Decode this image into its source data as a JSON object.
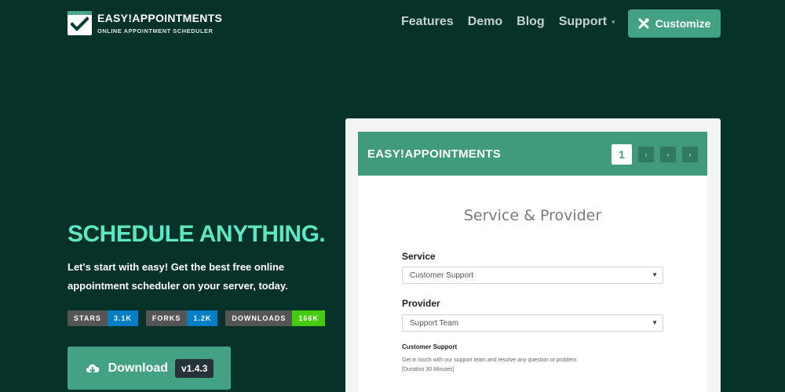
{
  "brand": {
    "title": "EASY!APPOINTMENTS",
    "subtitle": "ONLINE APPOINTMENT SCHEDULER",
    "icon": "calendar-check-icon"
  },
  "nav": {
    "items": [
      "Features",
      "Demo",
      "Blog",
      "Support"
    ],
    "support_caret": "▾",
    "customize_label": "Customize",
    "customize_icon": "tools-icon"
  },
  "hero": {
    "title": "SCHEDULE ANYTHING.",
    "text": "Let's start with easy! Get the best free online appointment scheduler on your server, today."
  },
  "badges": [
    {
      "label": "STARS",
      "value": "3.1K",
      "color": "#007ec6"
    },
    {
      "label": "FORKS",
      "value": "1.2K",
      "color": "#007ec6"
    },
    {
      "label": "DOWNLOADS",
      "value": "166K",
      "color": "#44cc11"
    }
  ],
  "download": {
    "label": "Download",
    "version": "v1.4.3",
    "icon": "cloud-download-icon"
  },
  "preview": {
    "brand": "EASY!APPOINTMENTS",
    "steps": [
      "1",
      "›",
      "›",
      "‹"
    ],
    "form_title": "Service & Provider",
    "service_label": "Service",
    "service_value": "Customer Support",
    "provider_label": "Provider",
    "provider_value": "Support Team",
    "description_title": "Customer Support",
    "description_text": "Get in touch with our support team and resolve any question or problem.",
    "description_duration": "[Duration 30 Minutes]"
  },
  "colors": {
    "background": "#063229",
    "accent": "#43a283",
    "hero_title": "#5de8c2"
  }
}
